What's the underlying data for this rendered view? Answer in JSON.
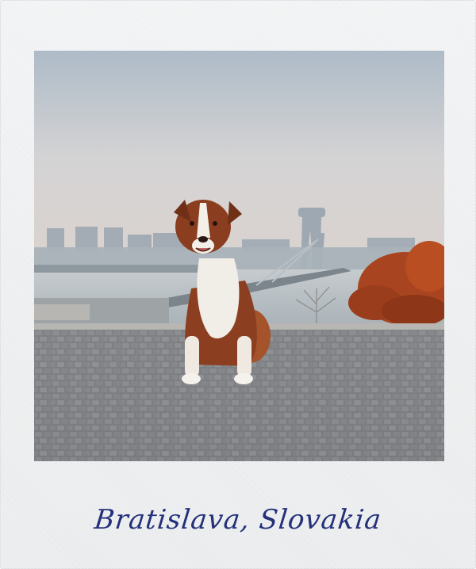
{
  "caption": "Bratislava, Slovakia",
  "photo": {
    "subject": "dog-on-cobblestones",
    "colors": {
      "sky_top": "#b6c1cc",
      "sky_bottom": "#ddd8d6",
      "city_haze": "#a9b4bd",
      "river": "#c8cdd2",
      "cobblestone": "#7c7d80",
      "dog_brown": "#8a3e1f",
      "dog_white": "#f2eee8",
      "foliage": "#b4461d"
    }
  }
}
